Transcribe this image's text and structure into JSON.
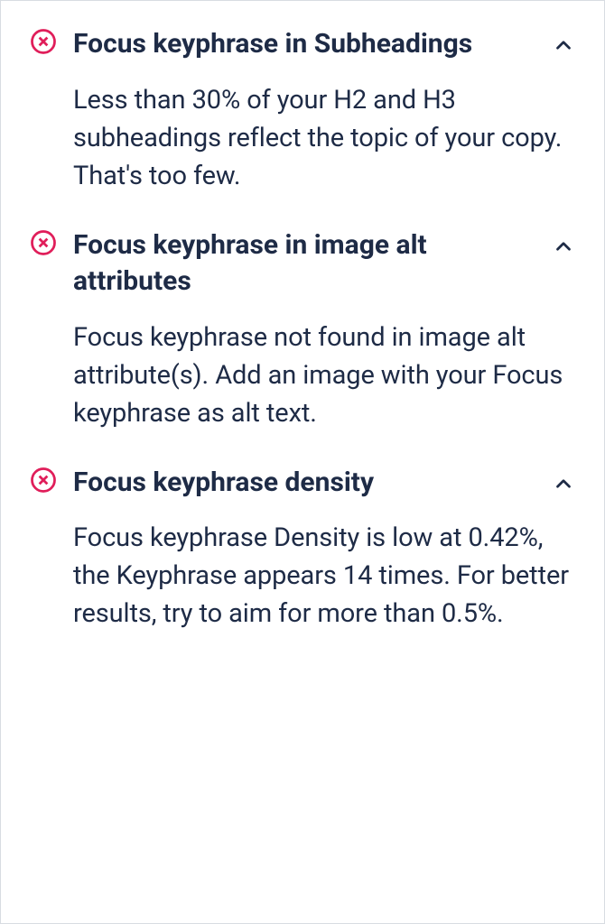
{
  "items": [
    {
      "status": "error",
      "title": "Focus keyphrase in Subheadings",
      "description": "Less than 30% of your H2 and H3 subheadings reflect the topic of your copy. That's too few."
    },
    {
      "status": "error",
      "title": "Focus keyphrase in image alt attributes",
      "description": "Focus keyphrase not found in image alt attribute(s). Add an image with your Focus keyphrase as alt text."
    },
    {
      "status": "error",
      "title": "Focus keyphrase density",
      "description": "Focus keyphrase Density is low at 0.42%, the Keyphrase appears 14 times. For better results, try to aim for more than 0.5%."
    }
  ],
  "colors": {
    "error": "#e01e5a",
    "text": "#1e2b46"
  }
}
